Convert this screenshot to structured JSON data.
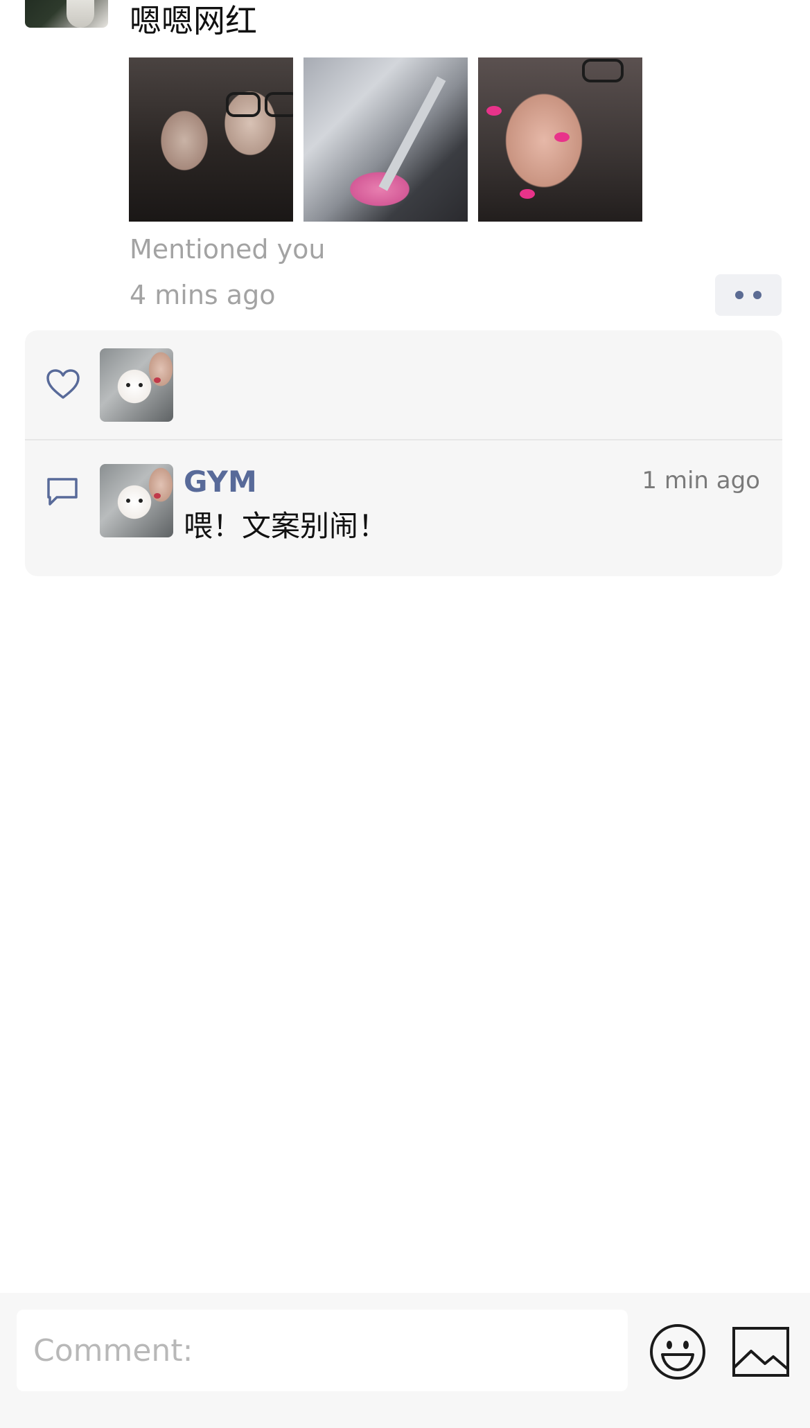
{
  "post": {
    "text": "嗯嗯网红",
    "mention_note": "Mentioned you",
    "time": "4 mins ago",
    "photos": [
      "photo-selfie",
      "photo-train",
      "photo-hand"
    ]
  },
  "likes": {
    "icon": "heart-icon",
    "avatars": [
      "liker-avatar"
    ]
  },
  "comments": [
    {
      "name": "GYM",
      "time": "1 min ago",
      "text": "喂！文案别闹！"
    }
  ],
  "composer": {
    "placeholder": "Comment:",
    "emoji_icon": "smiley-icon",
    "image_icon": "image-icon"
  },
  "colors": {
    "accent": "#586a99",
    "panel": "#f6f6f6",
    "muted_text": "#a3a3a3"
  }
}
